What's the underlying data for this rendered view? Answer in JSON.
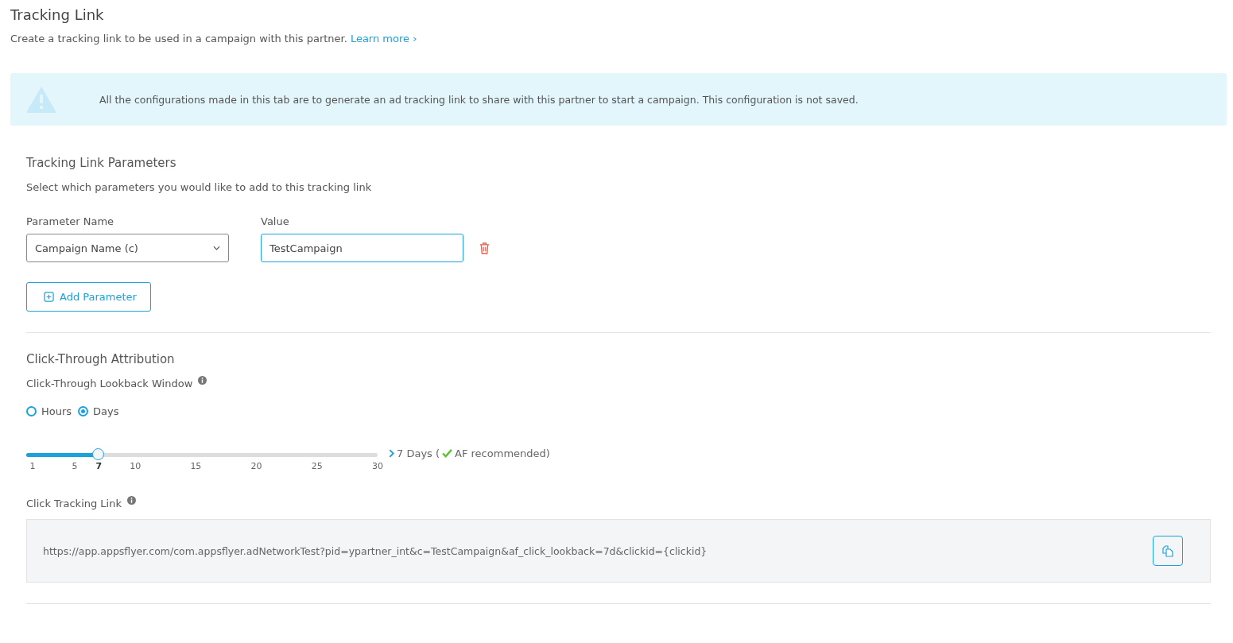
{
  "header": {
    "title": "Tracking Link",
    "description": "Create a tracking link to be used in a campaign with this partner.",
    "link": "Learn more ›"
  },
  "notice": {
    "text": "All the configurations made in this tab are to generate an ad tracking link to share with this partner to start a campaign. This configuration is not saved."
  },
  "parameters": {
    "title": "Tracking Link Parameters",
    "description": "Select which parameters you would like to add to this tracking link",
    "name_label": "Parameter Name",
    "value_label": "Value",
    "rows": [
      {
        "name": "Campaign Name (c)",
        "value": "TestCampaign"
      }
    ],
    "add_button": "Add Parameter"
  },
  "attribution": {
    "title": "Click-Through Attribution",
    "lookback_label": "Click-Through Lookback Window",
    "units": [
      {
        "label": "Hours",
        "selected": false
      },
      {
        "label": "Days",
        "selected": true
      }
    ],
    "slider": {
      "level": 0.207,
      "ticks": [
        {
          "label": "1",
          "selected": false
        },
        {
          "label": "5",
          "selected": false
        },
        {
          "label": "7",
          "selected": true
        },
        {
          "label": "10",
          "selected": false
        },
        {
          "label": "15",
          "selected": false
        },
        {
          "label": "20",
          "selected": false
        },
        {
          "label": "25",
          "selected": false
        },
        {
          "label": "30",
          "selected": false
        }
      ],
      "reading": "7 Days (",
      "recommendation": "AF recommended)"
    }
  },
  "click_link": {
    "label": "Click Tracking Link",
    "url": "https://app.appsflyer.com/com.appsflyer.adNetworkTest?pid=ypartner_int&c=TestCampaign&af_click_lookback=7d&clickid={clickid}"
  }
}
